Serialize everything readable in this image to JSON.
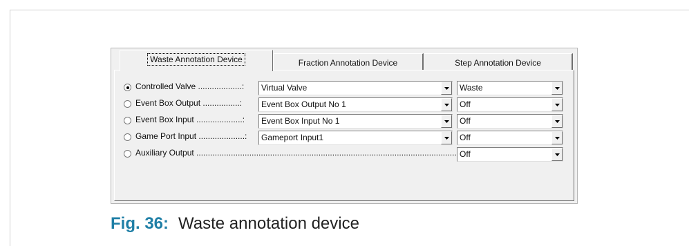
{
  "tabs": [
    {
      "label": "Waste Annotation Device",
      "active": true
    },
    {
      "label": "Fraction Annotation Device",
      "active": false
    },
    {
      "label": "Step Annotation Device",
      "active": false
    }
  ],
  "rows": [
    {
      "label": "Controlled Valve ...................:",
      "selected": true,
      "device": "Virtual Valve",
      "state": "Waste"
    },
    {
      "label": "Event Box Output ................:",
      "selected": false,
      "device": "Event Box Output No 1",
      "state": "Off"
    },
    {
      "label": "Event Box Input ....................:",
      "selected": false,
      "device": "Event Box Input No 1",
      "state": "Off"
    },
    {
      "label": "Game Port Input ....................:",
      "selected": false,
      "device": "Gameport Input1",
      "state": "Off"
    },
    {
      "label": "Auxiliary Output .......................................................................................................................:",
      "selected": false,
      "device": null,
      "state": "Off"
    }
  ],
  "caption": {
    "figure": "Fig. 36:",
    "text": "Waste annotation device"
  },
  "colors": {
    "accent": "#1f7fa6",
    "dialog_bg": "#f0f0f0"
  }
}
